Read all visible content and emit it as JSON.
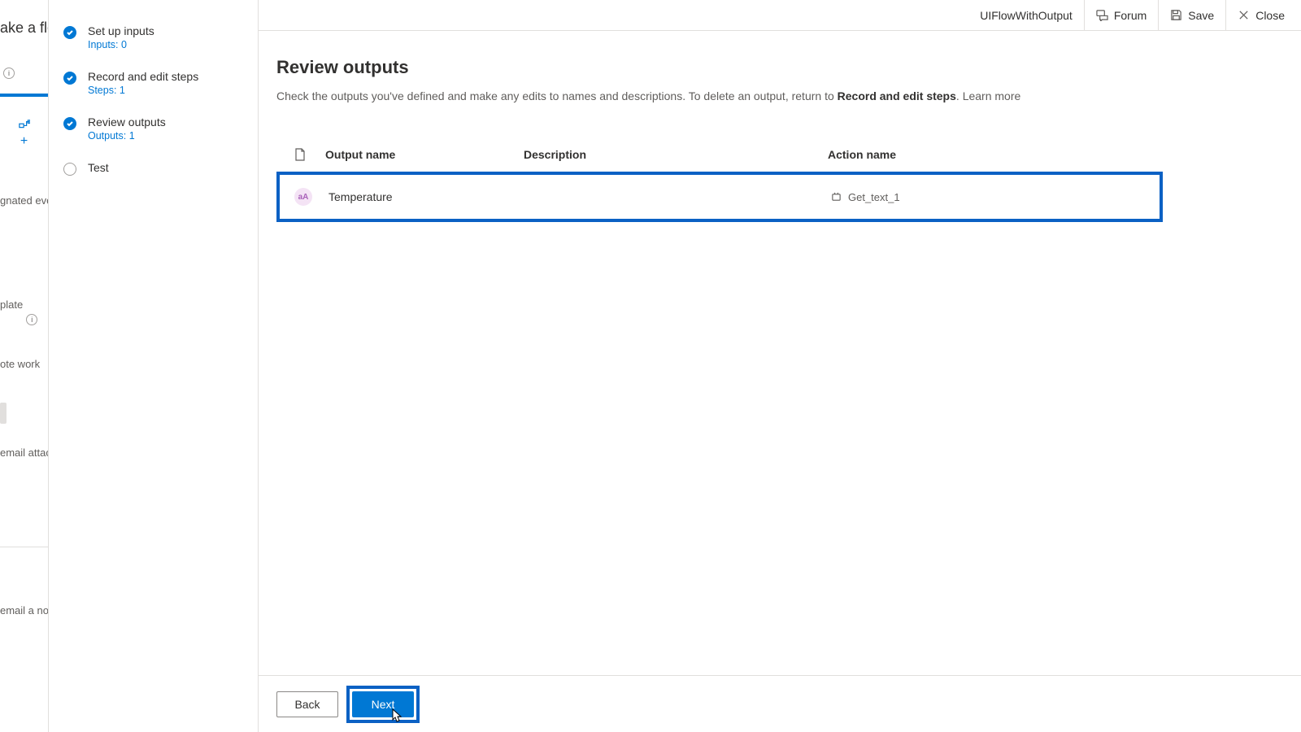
{
  "farleft": {
    "title_fragment": "ake a flo",
    "nav_events": "gnated even",
    "nav_plate": "plate",
    "nav_work": "ote work",
    "nav_email_attach": "email attac",
    "nav_email_note": "email a no"
  },
  "steps": [
    {
      "label": "Set up inputs",
      "sub": "Inputs: 0",
      "state": "done"
    },
    {
      "label": "Record and edit steps",
      "sub": "Steps: 1",
      "state": "done"
    },
    {
      "label": "Review outputs",
      "sub": "Outputs: 1",
      "state": "done"
    },
    {
      "label": "Test",
      "sub": "",
      "state": "todo"
    }
  ],
  "topbar": {
    "flow_name": "UIFlowWithOutput",
    "forum": "Forum",
    "save": "Save",
    "close": "Close"
  },
  "page": {
    "title": "Review outputs",
    "desc_pre": "Check the outputs you've defined and make any edits to names and descriptions. To delete an output, return to ",
    "desc_strong": "Record and edit steps",
    "desc_post": ". ",
    "learn_more": "Learn more"
  },
  "table": {
    "cols": {
      "output_name": "Output name",
      "description": "Description",
      "action_name": "Action name"
    },
    "rows": [
      {
        "badge": "aA",
        "output_name": "Temperature",
        "description": "",
        "action_name": "Get_text_1"
      }
    ]
  },
  "footer": {
    "back": "Back",
    "next": "Next"
  }
}
